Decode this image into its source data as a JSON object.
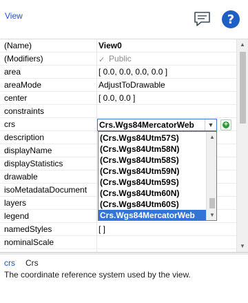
{
  "header": {
    "title": "View",
    "comment_icon": "speech-bubble-icon",
    "help_icon": "question-mark-icon"
  },
  "properties": [
    {
      "name": "(Name)",
      "value": "View0",
      "bold": true
    },
    {
      "name": "(Modifiers)",
      "value": "Public",
      "checkbox": true
    },
    {
      "name": "area",
      "value": "[ 0.0, 0.0, 0.0, 0.0 ]"
    },
    {
      "name": "areaMode",
      "value": "AdjustToDrawable"
    },
    {
      "name": "center",
      "value": "[ 0.0, 0.0 ]"
    },
    {
      "name": "constraints",
      "value": ""
    },
    {
      "name": "crs",
      "value": ""
    },
    {
      "name": "description",
      "value": ""
    },
    {
      "name": "displayName",
      "value": ""
    },
    {
      "name": "displayStatistics",
      "value": ""
    },
    {
      "name": "drawable",
      "value": ""
    },
    {
      "name": "isoMetadataDocument",
      "value": ""
    },
    {
      "name": "layers",
      "value": ""
    },
    {
      "name": "legend",
      "value": ""
    },
    {
      "name": "namedStyles",
      "value": "[ ]"
    },
    {
      "name": "nominalScale",
      "value": ""
    }
  ],
  "crs_combo": {
    "value": "Crs.Wgs84MercatorWeb",
    "options": [
      "(Crs.Wgs84Utm57S)",
      "(Crs.Wgs84Utm58N)",
      "(Crs.Wgs84Utm58S)",
      "(Crs.Wgs84Utm59N)",
      "(Crs.Wgs84Utm59S)",
      "(Crs.Wgs84Utm60N)",
      "(Crs.Wgs84Utm60S)",
      "Crs.Wgs84MercatorWeb"
    ],
    "selected_index": 7
  },
  "description_panel": {
    "property": "crs",
    "type": "Crs",
    "text": "The coordinate reference system used by the view."
  },
  "colors": {
    "accent": "#1f4fd8",
    "selection": "#3375d6",
    "add_green": "#2e9a3a"
  }
}
